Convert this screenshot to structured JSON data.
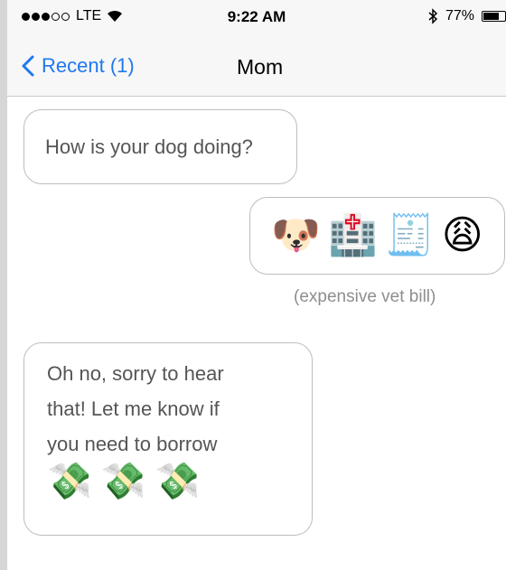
{
  "status_bar": {
    "carrier": "LTE",
    "time": "9:22 AM",
    "battery_percent": "77%",
    "battery_level": 0.77,
    "signal_bars_filled": 3,
    "signal_bars_total": 5
  },
  "nav": {
    "back_label": "Recent (1)",
    "title": "Mom"
  },
  "messages": [
    {
      "direction": "incoming",
      "text": "How is your dog doing?"
    },
    {
      "direction": "outgoing",
      "emoji": [
        "🐶",
        "🏥",
        "🧾",
        "😩"
      ],
      "caption": "(expensive vet bill)"
    },
    {
      "direction": "incoming",
      "lines": [
        "Oh no, sorry to hear",
        "that! Let me know if",
        "you need to borrow"
      ],
      "emoji": [
        "💸",
        "💸",
        "💸"
      ]
    }
  ],
  "colors": {
    "accent": "#1e78f0",
    "caption": "#8e8e8e"
  }
}
